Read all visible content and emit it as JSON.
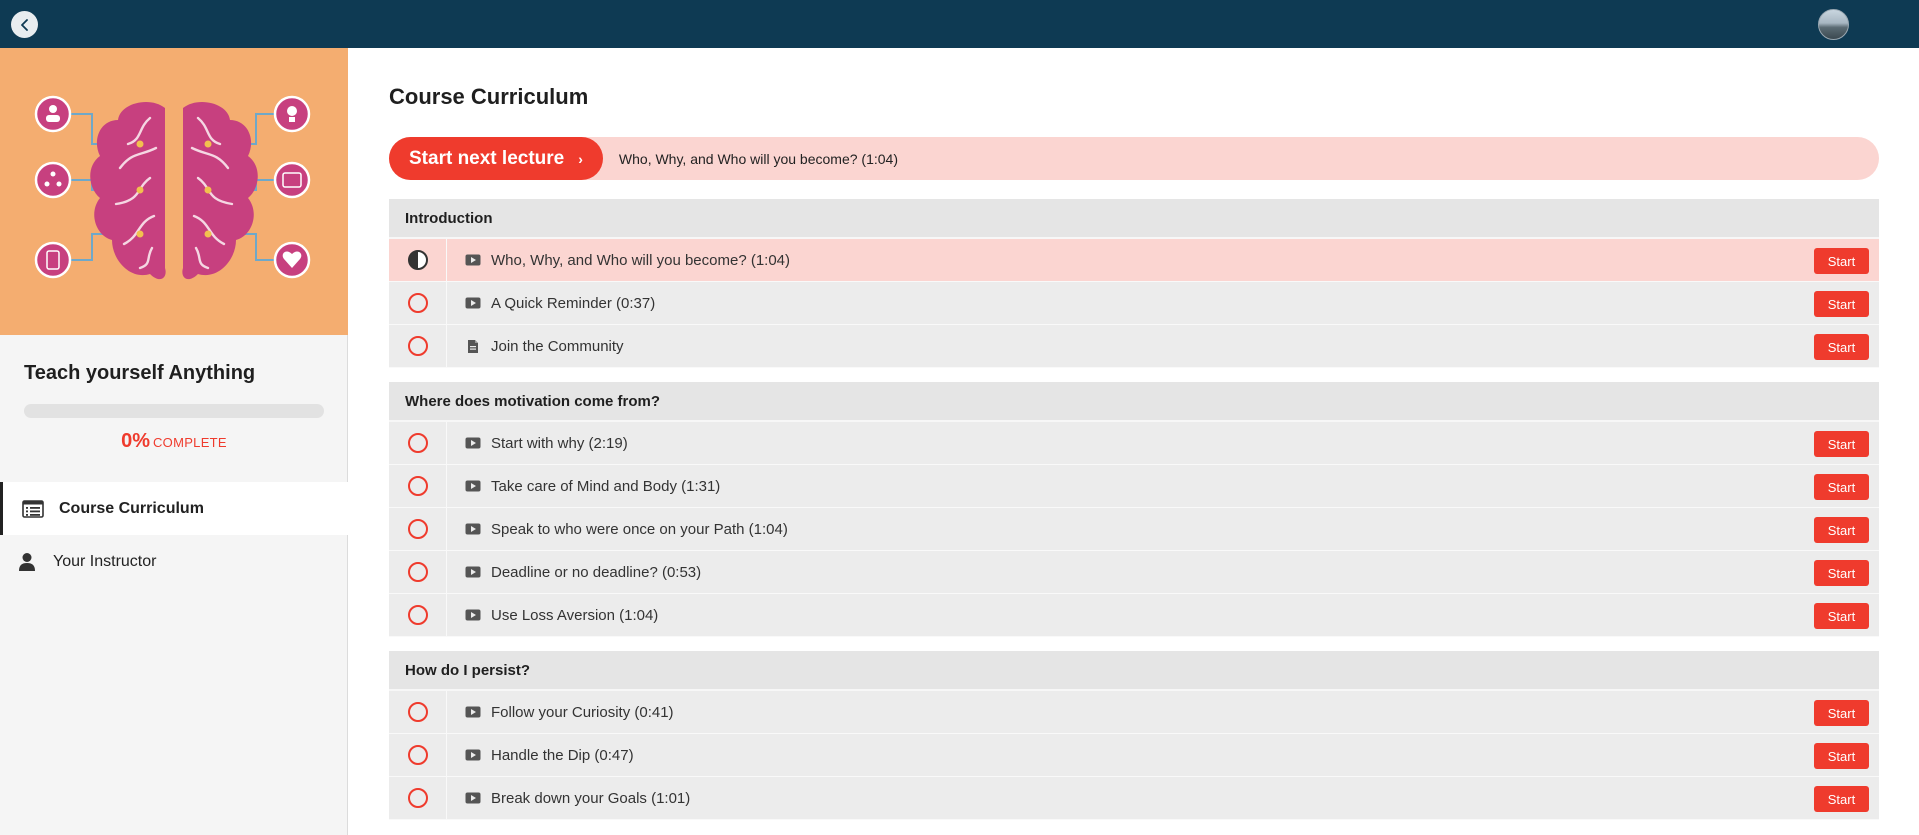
{
  "topbar": {
    "back_icon": "chevron-left-icon",
    "avatar_icon": "user-avatar"
  },
  "sidebar": {
    "course_title": "Teach yourself Anything",
    "progress": {
      "percent_value": 0,
      "percent_text": "0%",
      "label": "COMPLETE"
    },
    "nav": [
      {
        "label": "Course Curriculum",
        "icon": "curriculum-list-icon",
        "active": true
      },
      {
        "label": "Your Instructor",
        "icon": "person-icon",
        "active": false
      }
    ]
  },
  "main": {
    "title": "Course Curriculum",
    "next_lecture": {
      "button_label": "Start next lecture",
      "chevron": "›",
      "title": "Who, Why, and Who will you become? (1:04)"
    },
    "sections": [
      {
        "title": "Introduction",
        "lectures": [
          {
            "title": "Who, Why, and Who will you become? (1:04)",
            "type": "video",
            "status": "in-progress",
            "current": true,
            "button": "Start"
          },
          {
            "title": "A Quick Reminder (0:37)",
            "type": "video",
            "status": "not-started",
            "current": false,
            "button": "Start"
          },
          {
            "title": "Join the Community",
            "type": "document",
            "status": "not-started",
            "current": false,
            "button": "Start"
          }
        ]
      },
      {
        "title": "Where does motivation come from?",
        "lectures": [
          {
            "title": "Start with why (2:19)",
            "type": "video",
            "status": "not-started",
            "current": false,
            "button": "Start"
          },
          {
            "title": "Take care of Mind and Body (1:31)",
            "type": "video",
            "status": "not-started",
            "current": false,
            "button": "Start"
          },
          {
            "title": "Speak to who were once on your Path (1:04)",
            "type": "video",
            "status": "not-started",
            "current": false,
            "button": "Start"
          },
          {
            "title": "Deadline or no deadline? (0:53)",
            "type": "video",
            "status": "not-started",
            "current": false,
            "button": "Start"
          },
          {
            "title": "Use Loss Aversion (1:04)",
            "type": "video",
            "status": "not-started",
            "current": false,
            "button": "Start"
          }
        ]
      },
      {
        "title": "How do I persist?",
        "lectures": [
          {
            "title": "Follow your Curiosity (0:41)",
            "type": "video",
            "status": "not-started",
            "current": false,
            "button": "Start"
          },
          {
            "title": "Handle the Dip (0:47)",
            "type": "video",
            "status": "not-started",
            "current": false,
            "button": "Start"
          },
          {
            "title": "Break down your Goals (1:01)",
            "type": "video",
            "status": "not-started",
            "current": false,
            "button": "Start"
          }
        ]
      }
    ]
  },
  "colors": {
    "accent": "#ef3b2d",
    "topbar": "#0e3a53",
    "current_row": "#fbd5d1",
    "image_bg": "#f4ad70",
    "brain": "#c7407f"
  }
}
